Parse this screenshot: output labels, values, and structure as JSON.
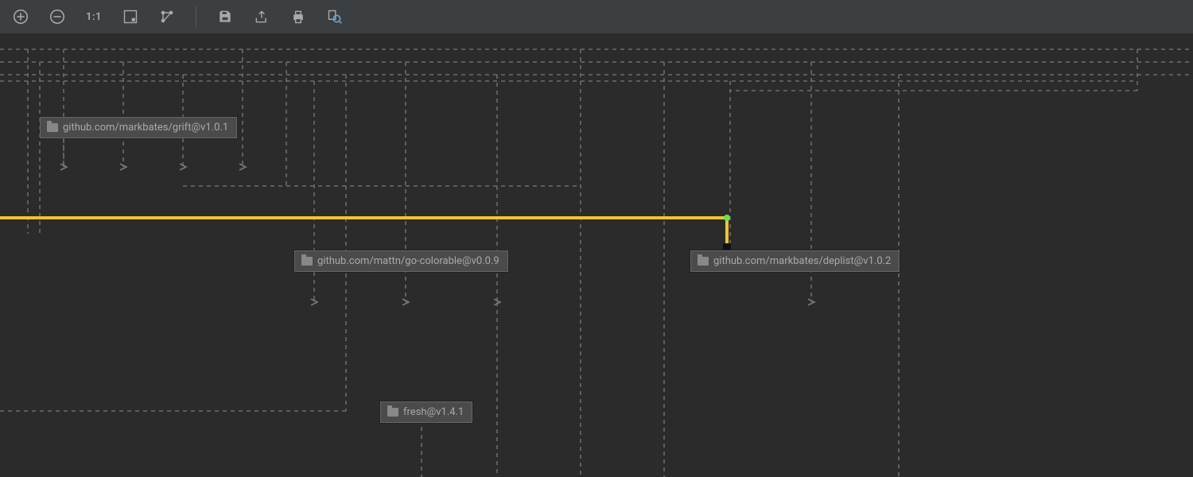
{
  "toolbar": {
    "zoom_in": "zoom-in",
    "zoom_out": "zoom-out",
    "actual_size": "1:1",
    "fit": "fit",
    "layout": "layout",
    "save": "save",
    "export": "export",
    "print": "print",
    "search": "search"
  },
  "nodes": {
    "grift": "github.com/markbates/grift@v1.0.1",
    "colorable": "github.com/mattn/go-colorable@v0.0.9",
    "deplist": "github.com/markbates/deplist@v1.0.2",
    "fresh": "fresh@v1.4.1"
  },
  "colors": {
    "highlight": "#f0c332",
    "dash": "#7a7a7a",
    "endpoint": "#6ae24a"
  }
}
